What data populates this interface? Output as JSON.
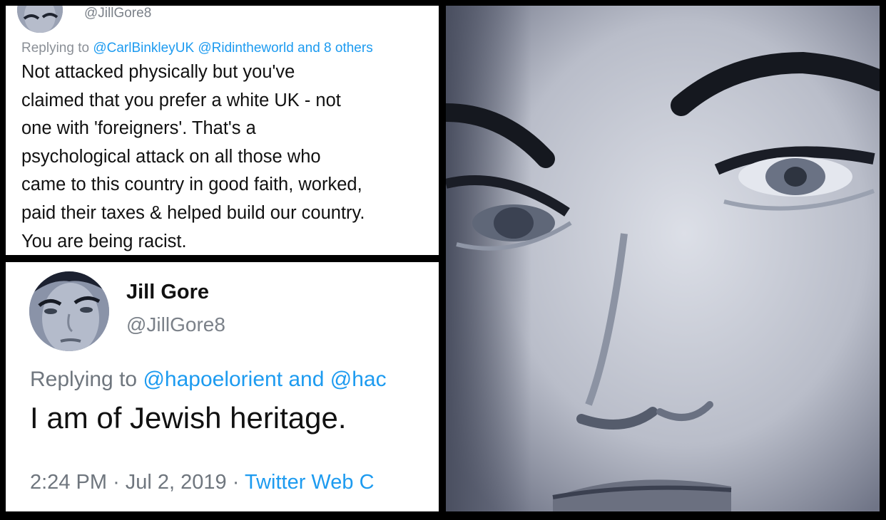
{
  "top_tweet": {
    "handle": "@JillGore8",
    "replying_prefix": "Replying to",
    "replying_mentions": "@CarlBinkleyUK @Ridintheworld and 8 others",
    "body_lines": [
      "Not attacked physically but you've",
      "claimed that you prefer a white UK - not",
      "one with 'foreigners'. That's a",
      "psychological attack on all those who",
      "came to this country in good faith, worked,",
      "paid their taxes & helped build our country.",
      "You are being racist."
    ]
  },
  "bottom_tweet": {
    "display_name": "Jill Gore",
    "handle": "@JillGore8",
    "replying_prefix": "Replying to",
    "replying_mentions": "@hapoelorient and @hac",
    "text": "I am of Jewish heritage.",
    "time": "2:24 PM",
    "separator": "·",
    "date": "Jul 2, 2019",
    "source": "Twitter Web C"
  },
  "colors": {
    "link": "#1d9bf0",
    "muted": "#8a8f96",
    "text": "#111111",
    "background": "#000000"
  },
  "icons": {
    "avatar": "face-closeup-avatar",
    "photo": "face-closeup-photo"
  }
}
